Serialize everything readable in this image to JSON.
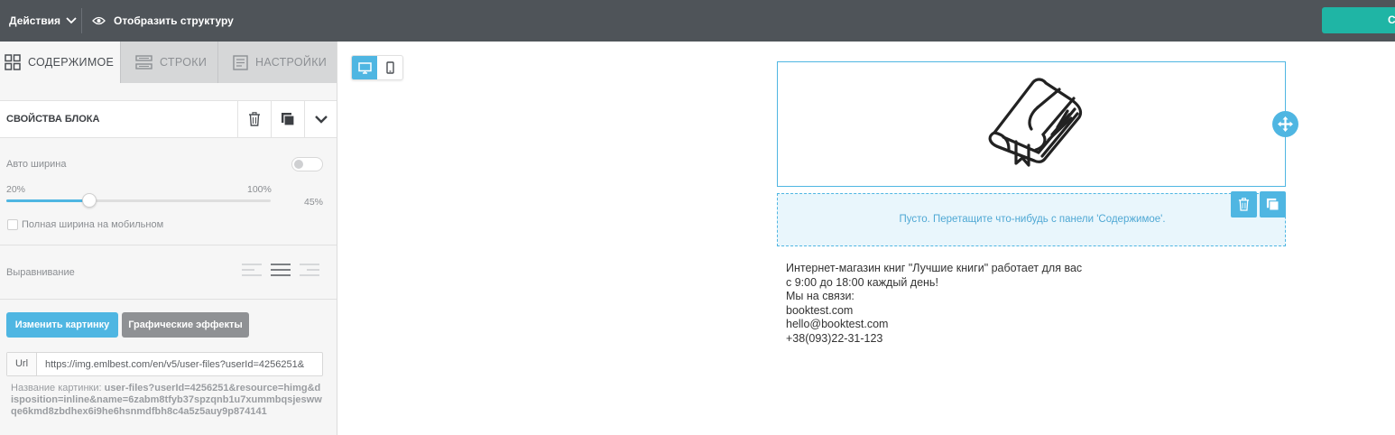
{
  "topbar": {
    "actions_label": "Действия",
    "structure_label": "Отобразить структуру",
    "save_label": "Сохранить"
  },
  "tabs": [
    {
      "label": "СОДЕРЖИМОЕ",
      "icon": "grid-icon",
      "active": true
    },
    {
      "label": "СТРОКИ",
      "icon": "rows-icon",
      "active": false
    },
    {
      "label": "НАСТРОЙКИ",
      "icon": "settings-doc-icon",
      "active": false
    }
  ],
  "block_props": {
    "title": "СВОЙСТВА БЛОКА",
    "auto_width_label": "Авто ширина",
    "auto_width_on": false,
    "slider_min_label": "20%",
    "slider_max_label": "100%",
    "slider_value_label": "45%",
    "slider_value": 45,
    "slider_min": 20,
    "slider_max": 100,
    "full_width_mobile_label": "Полная ширина на мобильном",
    "full_width_mobile_checked": false,
    "alignment_label": "Выравнивание",
    "alignment_selected": "center",
    "change_image_label": "Изменить картинку",
    "effects_label": "Графические эффекты",
    "url_label": "Url",
    "url_value": "https://img.emlbest.com/en/v5/user-files?userId=4256251&",
    "image_name_label": "Название картинки:",
    "image_name_value": "user-files?userId=4256251&resource=himg&disposition=inline&name=6zabm8tfyb37spzqnb1u7xummbqsjeswwqe6kmd8zbdhex6i9he6hsnmdfbh8c4a5z5auy9p874141"
  },
  "canvas": {
    "device_desktop": "desktop-icon",
    "device_mobile": "mobile-icon",
    "image_icon": "book-icon",
    "empty_message": "Пусто. Перетащите что-нибудь с панели 'Содержимое'.",
    "info_lines": [
      "Интернет-магазин книг \"Лучшие книги\" работает для вас",
      "с 9:00 до 18:00 каждый день!",
      "Мы на связи:",
      "booktest.com",
      "hello@booktest.com",
      "+38(093)22-31-123"
    ]
  },
  "colors": {
    "topbar": "#4f5459",
    "accent": "#4fb6e2",
    "save": "#1fb5a5"
  }
}
